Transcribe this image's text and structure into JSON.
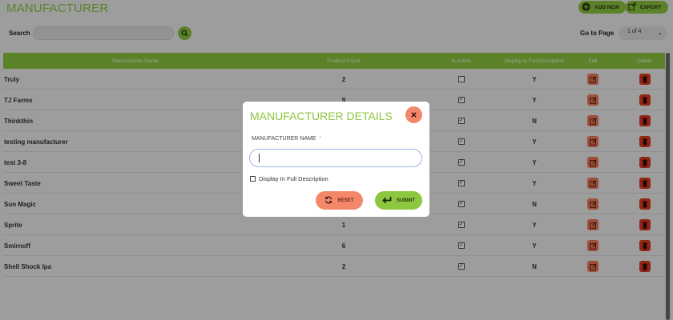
{
  "page": {
    "title": "MANUFACTURER",
    "add_new_label": "ADD NEW",
    "export_label": "EXPORT",
    "search_label": "Search",
    "search_value": "",
    "goto_label": "Go to Page",
    "goto_value": "1 of 4"
  },
  "table": {
    "headers": [
      "Manufacturer Name",
      "Product Count",
      "Is Active",
      "Display in Full Description",
      "Edit",
      "Delete"
    ],
    "rows": [
      {
        "name": "Truly",
        "count": "2",
        "active": false,
        "display": "Y"
      },
      {
        "name": "TJ Farms",
        "count": "9",
        "active": true,
        "display": "Y"
      },
      {
        "name": "Thinkthin",
        "count": "",
        "active": true,
        "display": "N"
      },
      {
        "name": "testing manufacturer",
        "count": "",
        "active": true,
        "display": "Y"
      },
      {
        "name": "test 3-8",
        "count": "",
        "active": true,
        "display": "Y"
      },
      {
        "name": "Sweet Taste",
        "count": "",
        "active": true,
        "display": "Y"
      },
      {
        "name": "Sun Magic",
        "count": "",
        "active": true,
        "display": "N"
      },
      {
        "name": "Sprite",
        "count": "1",
        "active": true,
        "display": "Y"
      },
      {
        "name": "Smirnoff",
        "count": "6",
        "active": true,
        "display": "Y"
      },
      {
        "name": "Shell Shock Ipa",
        "count": "2",
        "active": true,
        "display": "N"
      }
    ]
  },
  "modal": {
    "title": "MANUFACTURER DETAILS",
    "name_label": "MANUFACTURER NAME",
    "required_mark": "*",
    "name_value": "",
    "checkbox_label": "Display In Full Description",
    "checkbox_checked": false,
    "reset_label": "RESET",
    "submit_label": "SUBMIT"
  },
  "colors": {
    "accent": "#8dc63f",
    "edit": "#f07a5a",
    "delete": "#e03a1e",
    "reset": "#f4866a"
  }
}
